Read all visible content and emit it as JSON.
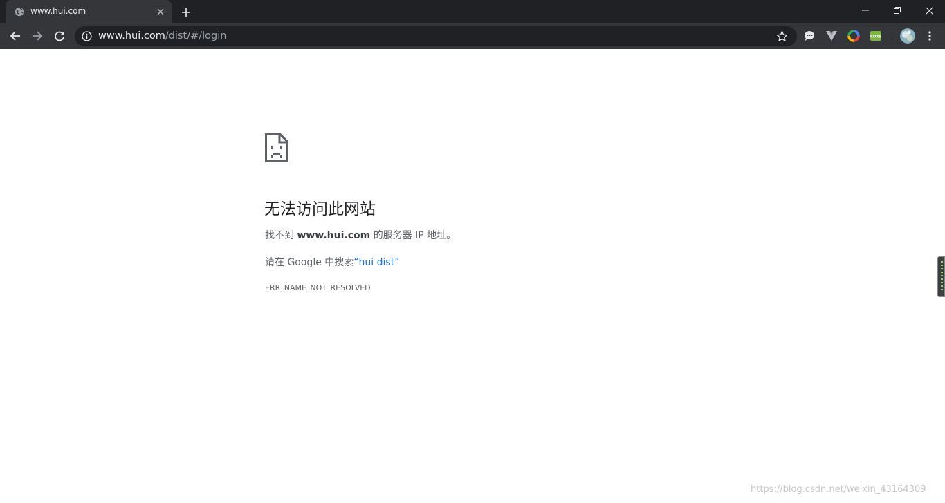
{
  "tab": {
    "title": "www.hui.com",
    "favicon": "globe-icon"
  },
  "omnibox": {
    "url_host": "www.hui.com",
    "url_path": "/dist/#/login"
  },
  "extensions": [
    "speech-bubble-icon",
    "vue-devtools-icon",
    "color-wheel-icon",
    "cors-icon"
  ],
  "extension_cors_label": "CORS",
  "error": {
    "heading": "无法访问此网站",
    "desc_prefix": "找不到",
    "desc_host": "www.hui.com",
    "desc_suffix": "的服务器 IP 地址。",
    "suggest_prefix": "请在 Google 中搜索",
    "suggest_link": "“hui dist”",
    "code": "ERR_NAME_NOT_RESOLVED"
  },
  "watermark": "https://blog.csdn.net/weixin_43164309",
  "colors": {
    "titlebar": "#202124",
    "toolbar": "#35363a",
    "link": "#1a73e8",
    "heading": "#202124",
    "body_text": "#5f6368"
  }
}
